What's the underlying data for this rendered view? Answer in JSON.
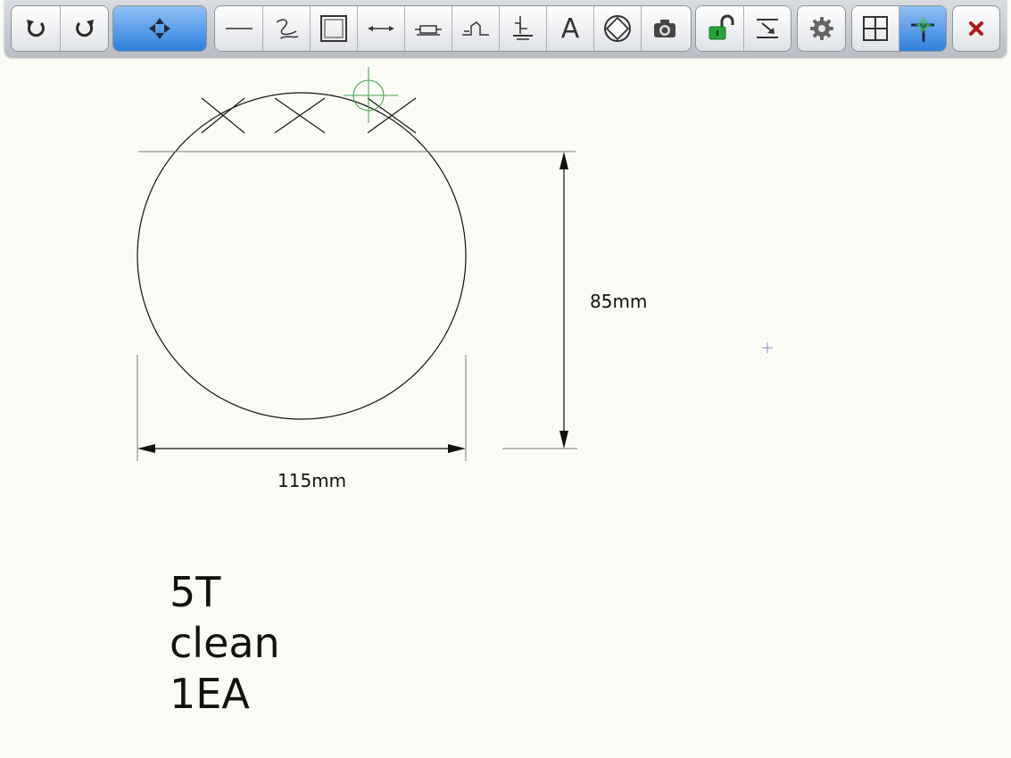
{
  "toolbar": {
    "groups": [
      {
        "name": "history",
        "buttons": [
          {
            "icon": "undo-icon"
          },
          {
            "icon": "redo-icon"
          }
        ]
      },
      {
        "name": "navigate",
        "buttons": [
          {
            "icon": "move-arrows-icon",
            "active": true
          }
        ]
      },
      {
        "name": "draw-tools",
        "buttons": [
          {
            "icon": "line-icon"
          },
          {
            "icon": "freehand-icon"
          },
          {
            "icon": "rectangle-icon"
          },
          {
            "icon": "dimension-icon"
          },
          {
            "icon": "resistor-icon"
          },
          {
            "icon": "step-icon"
          },
          {
            "icon": "weld-symbol-icon"
          },
          {
            "icon": "text-icon"
          },
          {
            "icon": "compass-icon"
          },
          {
            "icon": "camera-icon"
          }
        ]
      },
      {
        "name": "lock-tools",
        "buttons": [
          {
            "icon": "unlock-icon"
          },
          {
            "icon": "import-icon"
          }
        ]
      },
      {
        "name": "settings",
        "buttons": [
          {
            "icon": "gear-icon"
          }
        ]
      },
      {
        "name": "snap",
        "buttons": [
          {
            "icon": "grid-icon"
          },
          {
            "icon": "snap-cursor-icon",
            "active": true
          }
        ]
      },
      {
        "name": "close",
        "buttons": [
          {
            "icon": "close-icon"
          }
        ]
      }
    ],
    "text_tool_glyph": "A",
    "colors": {
      "active_blue": "#2f7fdc",
      "lock_green": "#2aa33a",
      "close_red": "#b01515"
    }
  },
  "drawing": {
    "width_dimension": "115mm",
    "height_dimension": "85mm",
    "stroke_color": "#111111",
    "guide_color": "#777777",
    "cursor_color": "#3aa04a",
    "marker_color": "#8888cc"
  },
  "note": {
    "lines": [
      "5T",
      "clean",
      "1EA"
    ]
  }
}
